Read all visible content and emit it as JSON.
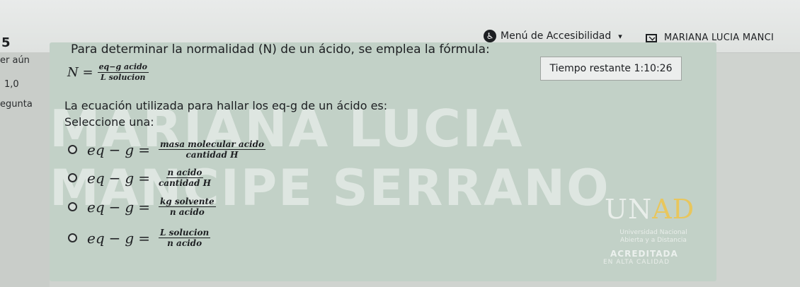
{
  "header": {
    "section_number": "5",
    "accessibility_menu_label": "Menú de Accesibilidad",
    "user_name": "MARIANA LUCIA MANCI"
  },
  "sidebar": {
    "status": "er aún",
    "score": "1,0",
    "question_label": "egunta"
  },
  "question": {
    "intro": "Para determinar la normalidad (N) de un ácido, se emplea la fórmula:",
    "formula_lhs": "N =",
    "formula_numerator": "eq−g acido",
    "formula_denominator": "L solucion",
    "prompt": "La ecuación utilizada para hallar los eq-g de un ácido es:",
    "select_label": "Seleccione una:",
    "options": [
      {
        "lhs": "eq",
        "numerator": "masa molecular acido",
        "denominator": "cantidad H"
      },
      {
        "lhs": "eq",
        "numerator": "n acido",
        "denominator": "cantidad H"
      },
      {
        "lhs": "eq",
        "numerator": "kg solvente",
        "denominator": "n acido"
      },
      {
        "lhs": "eq",
        "numerator": "L solucion",
        "denominator": "n acido"
      }
    ],
    "g_symbol": "g",
    "minus": "−",
    "equals": "="
  },
  "timer": {
    "label": "Tiempo restante",
    "value": "1:10:26"
  },
  "watermark": {
    "line1": "MARIANA LUCIA",
    "line2": "MANCIPE SERRANO"
  },
  "logo": {
    "brand_main": "UN",
    "brand_accent": "AD",
    "subtitle_line1": "Universidad Nacional",
    "subtitle_line2": "Abierta y a Distancia",
    "accreditation": "ACREDITADA",
    "quality": "EN ALTA CALIDAD"
  }
}
